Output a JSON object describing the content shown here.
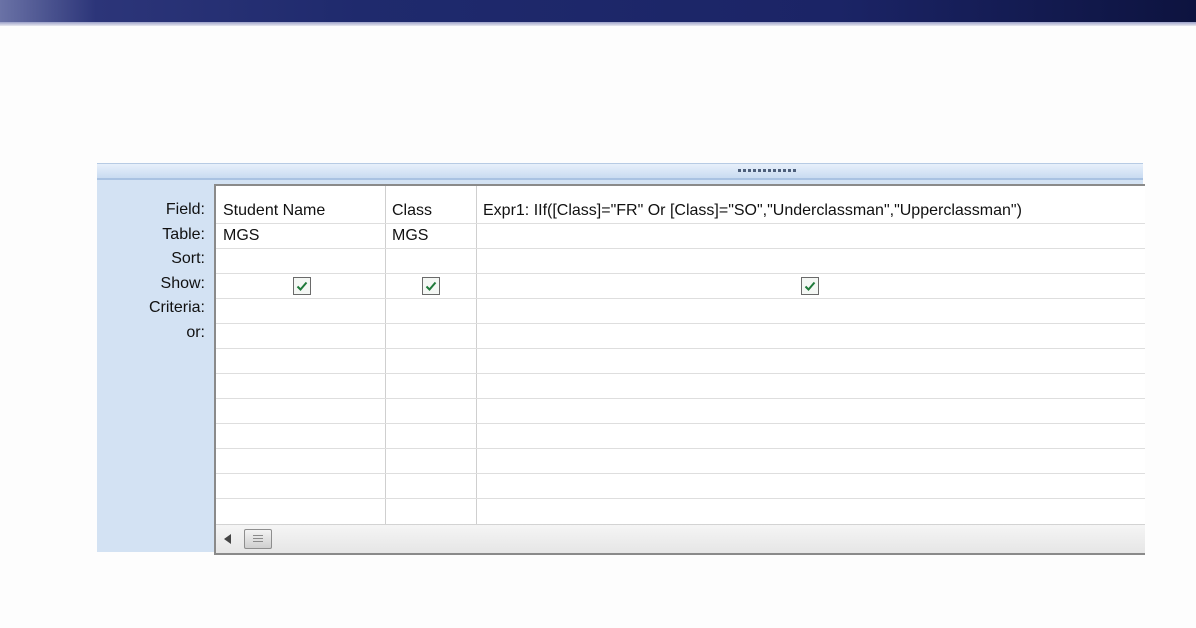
{
  "design_grid": {
    "row_labels": [
      "Field:",
      "Table:",
      "Sort:",
      "Show:",
      "Criteria:",
      "or:"
    ],
    "columns": [
      {
        "field": "Student Name",
        "table": "MGS",
        "show": true
      },
      {
        "field": "Class",
        "table": "MGS",
        "show": true
      },
      {
        "field": "Expr1: IIf([Class]=\"FR\" Or [Class]=\"SO\",\"Underclassman\",\"Upperclassman\")",
        "table": "",
        "show": true
      }
    ]
  },
  "colors": {
    "title_band": "#1f2a6d",
    "panel_background": "#d3e2f3",
    "grid_background": "#ffffff"
  }
}
